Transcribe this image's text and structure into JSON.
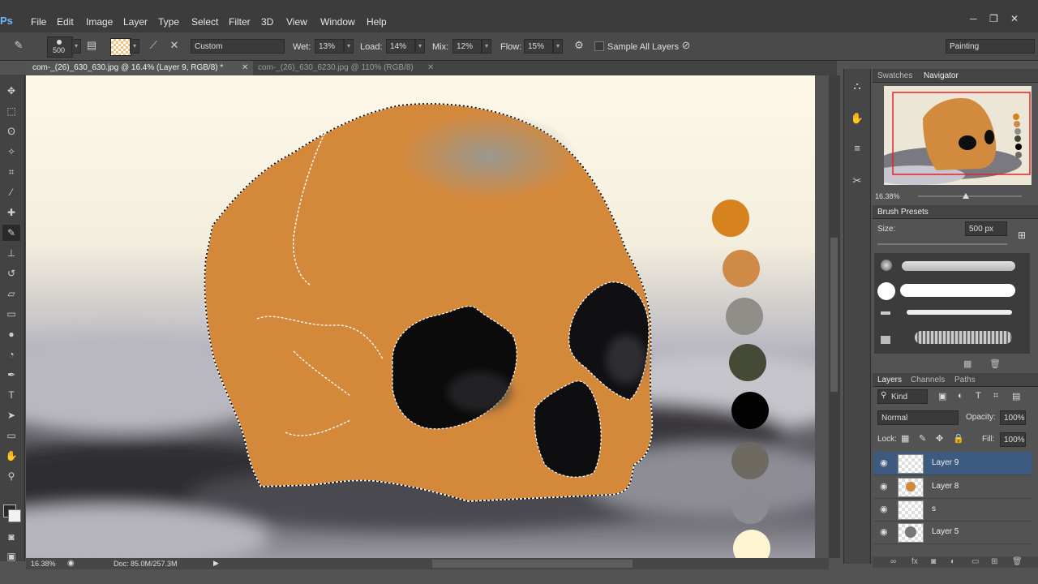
{
  "app": {
    "logo": "Ps"
  },
  "menu": [
    "File",
    "Edit",
    "Image",
    "Layer",
    "Type",
    "Select",
    "Filter",
    "3D",
    "View",
    "Window",
    "Help"
  ],
  "window_controls": [
    "─",
    "❐",
    "✕"
  ],
  "options": {
    "brush_size": "500",
    "preset": "Custom",
    "wet_label": "Wet:",
    "wet_value": "13%",
    "load_label": "Load:",
    "load_value": "14%",
    "mix_label": "Mix:",
    "mix_value": "12%",
    "flow_label": "Flow:",
    "flow_value": "15%",
    "sample_all_layers": "Sample All Layers",
    "workspace": "Painting"
  },
  "tabs": [
    {
      "label": "com-_(26)_630_630.jpg @ 16.4% (Layer 9, RGB/8) *",
      "close": "✕",
      "active": true
    },
    {
      "label": "com-_(26)_630_6230.jpg @ 110% (RGB/8)",
      "close": "✕",
      "active": false
    }
  ],
  "status": {
    "zoom": "16.38%",
    "doc": "Doc: 85.0M/257.3M"
  },
  "navigator": {
    "tabs": [
      "Swatches",
      "Navigator"
    ],
    "zoom": "16.38%"
  },
  "brush_presets": {
    "title": "Brush Presets",
    "size_label": "Size:",
    "size_value": "500 px"
  },
  "layers_panel": {
    "tabs": [
      "Layers",
      "Channels",
      "Paths"
    ],
    "kind": "Kind",
    "blend_mode": "Normal",
    "opacity_label": "Opacity:",
    "opacity_value": "100%",
    "lock_label": "Lock:",
    "fill_label": "Fill:",
    "fill_value": "100%",
    "layers": [
      {
        "name": "Layer 9",
        "selected": true
      },
      {
        "name": "Layer 8",
        "selected": false
      },
      {
        "name": "s",
        "selected": false
      },
      {
        "name": "Layer 5",
        "selected": false
      }
    ]
  },
  "palette_colors": [
    "#d6821f",
    "#cf8a48",
    "#8f8e89",
    "#454a36",
    "#030303",
    "#6e6a61",
    "#8d8c92",
    "#fdf4d2"
  ]
}
